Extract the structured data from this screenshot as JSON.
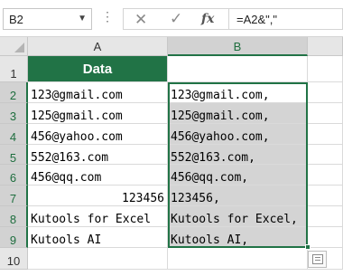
{
  "formula_bar": {
    "name_box": "B2",
    "cancel_symbol": "✕",
    "enter_symbol": "✓",
    "function_symbol": "fx",
    "formula": "=A2&\",\""
  },
  "columns": [
    {
      "label": "A"
    },
    {
      "label": "B"
    }
  ],
  "rows": [
    {
      "number": "1",
      "a": "Data",
      "b": ""
    },
    {
      "number": "2",
      "a": "123@gmail.com",
      "b": "123@gmail.com,"
    },
    {
      "number": "3",
      "a": "125@gmail.com",
      "b": "125@gmail.com,"
    },
    {
      "number": "4",
      "a": "456@yahoo.com",
      "b": "456@yahoo.com,"
    },
    {
      "number": "5",
      "a": "552@163.com",
      "b": "552@163.com,"
    },
    {
      "number": "6",
      "a": "456@qq.com",
      "b": "456@qq.com,"
    },
    {
      "number": "7",
      "a": "123456",
      "b": "123456,"
    },
    {
      "number": "8",
      "a": "Kutools for Excel",
      "b": "Kutools for Excel,"
    },
    {
      "number": "9",
      "a": "Kutools AI",
      "b": "Kutools AI,"
    },
    {
      "number": "10",
      "a": "",
      "b": ""
    }
  ],
  "colors": {
    "header_fill": "#217346",
    "selection_border": "#217346",
    "selection_shade": "#d4d4d4"
  },
  "icons": {
    "quick_analysis": "quick-analysis-icon"
  }
}
